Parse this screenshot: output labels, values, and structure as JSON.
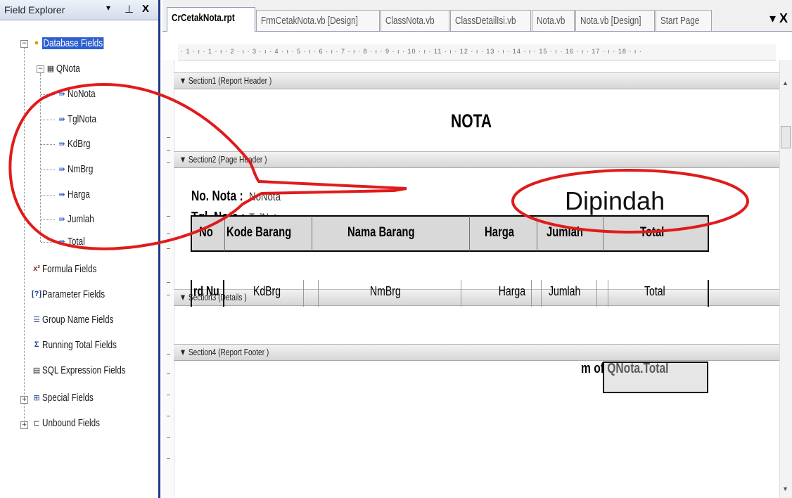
{
  "explorer": {
    "title": "Field Explorer",
    "controls": {
      "dropdown": "▾",
      "pin": "⊥",
      "close": "X"
    },
    "items": [
      {
        "label": "Database Fields",
        "icon": "database-icon"
      },
      {
        "label": "QNota",
        "icon": "table-icon"
      },
      {
        "label": "NoNota",
        "icon": "field-icon"
      },
      {
        "label": "TglNota",
        "icon": "field-icon"
      },
      {
        "label": "KdBrg",
        "icon": "field-icon"
      },
      {
        "label": "NmBrg",
        "icon": "field-icon"
      },
      {
        "label": "Harga",
        "icon": "field-icon"
      },
      {
        "label": "Jumlah",
        "icon": "field-icon"
      },
      {
        "label": "Total",
        "icon": "field-icon"
      },
      {
        "label": "Formula Fields",
        "icon": "formula-icon"
      },
      {
        "label": "Parameter Fields",
        "icon": "parameter-icon"
      },
      {
        "label": "Group Name Fields",
        "icon": "group-icon"
      },
      {
        "label": "Running Total Fields",
        "icon": "sigma-icon"
      },
      {
        "label": "SQL Expression Fields",
        "icon": "sql-icon"
      },
      {
        "label": "Special Fields",
        "icon": "special-icon"
      },
      {
        "label": "Unbound Fields",
        "icon": "unbound-icon"
      }
    ]
  },
  "tabs": [
    {
      "label": "CrCetakNota.rpt",
      "active": true
    },
    {
      "label": "FrmCetakNota.vb [Design]"
    },
    {
      "label": "ClassNota.vb"
    },
    {
      "label": "ClassDetailIsi.vb"
    },
    {
      "label": "Nota.vb"
    },
    {
      "label": "Nota.vb [Design]"
    },
    {
      "label": "Start Page"
    }
  ],
  "tab_controls": "▾ X",
  "ruler_text": "· 1 · ı · 1 · ı · 2 · ı · 3 · ı · 4 · ı · 5 · ı · 6 · ı · 7 · ı · 8 · ı · 9 · ı · 10 · ı · 11 · ı · 12 · ı · 13 · ı · 14 · ı · 15 · ı · 16 · ı · 17 · ı · 18 · ı ·",
  "sections": {
    "s1": "▼ Section1 (Report Header )",
    "s2": "▼ Section2 (Page Header )",
    "s3": "▼ Section3 (Details )",
    "s4": "▼ Section4 (Report Footer )"
  },
  "report": {
    "title": "NOTA",
    "no_nota_label": "No. Nota :",
    "no_nota_field": "NoNota",
    "tgl_nota_label": "Tgl. Nota :",
    "tgl_nota_field": "TglNota",
    "headers": [
      "No",
      "Kode Barang",
      "Nama Barang",
      "Harga",
      "Jumlah",
      "Total"
    ],
    "details": [
      "rd Nu",
      "KdBrg",
      "NmBrg",
      "Harga",
      "Jumlah",
      "Total"
    ],
    "footer_sum": "m of QNota.Total"
  },
  "annotation": {
    "text": "Dipindah",
    "color": "#e01b1b"
  }
}
